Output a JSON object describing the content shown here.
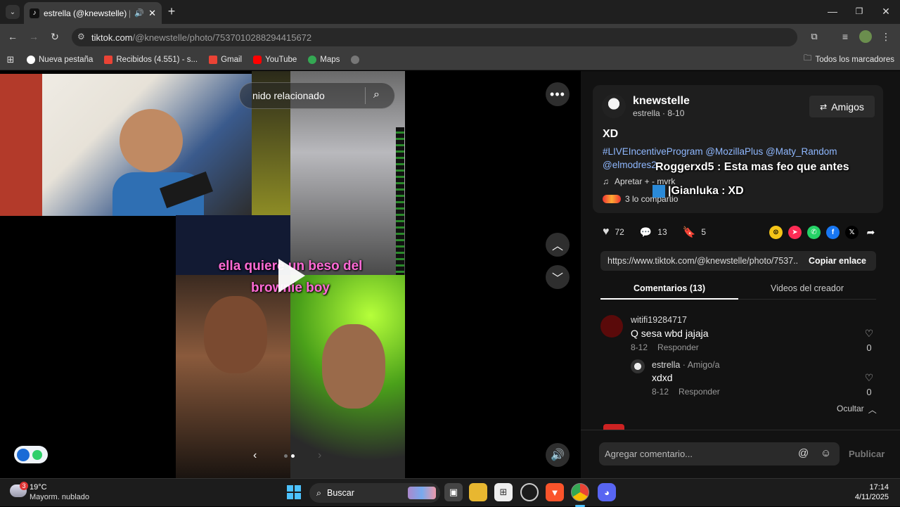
{
  "browser": {
    "tab_title": "estrella (@knewstelle) | TikT",
    "tab_favicon": "♪",
    "new_tab_symbol": "+",
    "url_host": "tiktok.com",
    "url_path": "/@knewstelle/photo/7537010288294415672",
    "bookmarks": [
      {
        "label": "Nueva pestaña",
        "color": "#ffffff"
      },
      {
        "label": "Recibidos (4.551) - s...",
        "color": "#ea4335"
      },
      {
        "label": "Gmail",
        "color": "#ea4335"
      },
      {
        "label": "YouTube",
        "color": "#ff0000"
      },
      {
        "label": "Maps",
        "color": "#34a853"
      }
    ],
    "all_bookmarks": "Todos los marcadores"
  },
  "viewer": {
    "search_placeholder": "nido relacionado",
    "caption_line1": "ella quiere un beso del",
    "caption_line2": "brownie boy",
    "comment_overlay_1_user": "Roggerxd5",
    "comment_overlay_1_text": "Esta mas feo que antes",
    "comment_overlay_2_user": "|Gianluka",
    "comment_overlay_2_text": "XD",
    "slide_count": 2,
    "active_slide": 2
  },
  "post": {
    "username": "knewstelle",
    "display_meta": "estrella · 8-10",
    "friends_button": "Amigos",
    "title": "XD",
    "hashtags_line1": "#LIVEIncentiveProgram @MozillaPlus @Maty_Random",
    "hashtags_line2": "@elmodres2",
    "music": "Apretar + - mvrk",
    "shared": "3 lo compartio",
    "likes": "72",
    "comments": "13",
    "saves": "5",
    "link": "https://www.tiktok.com/@knewstelle/photo/7537...",
    "copy_link": "Copiar enlace",
    "share_colors": [
      "#f5c518",
      "#fe2c55",
      "#25d366",
      "#1877f2",
      "#000000"
    ]
  },
  "tabs": {
    "comments": "Comentarios (13)",
    "creator_videos": "Videos del creador"
  },
  "comments": [
    {
      "user": "witifi19284717",
      "text": "Q sesa wbd jajaja",
      "date": "8-12",
      "reply": "Responder",
      "likes": "0"
    },
    {
      "user": "estrella",
      "badge": " · Amigo/a",
      "text": "xdxd",
      "date": "8-12",
      "reply": "Responder",
      "likes": "0"
    }
  ],
  "hide_replies": "Ocultar",
  "comment_input": {
    "placeholder": "Agregar comentario...",
    "publish": "Publicar"
  },
  "taskbar": {
    "temp": "19°C",
    "weather": "Mayorm. nublado",
    "weather_badge": "3",
    "search": "Buscar",
    "time": "17:14",
    "date": "4/11/2025"
  }
}
